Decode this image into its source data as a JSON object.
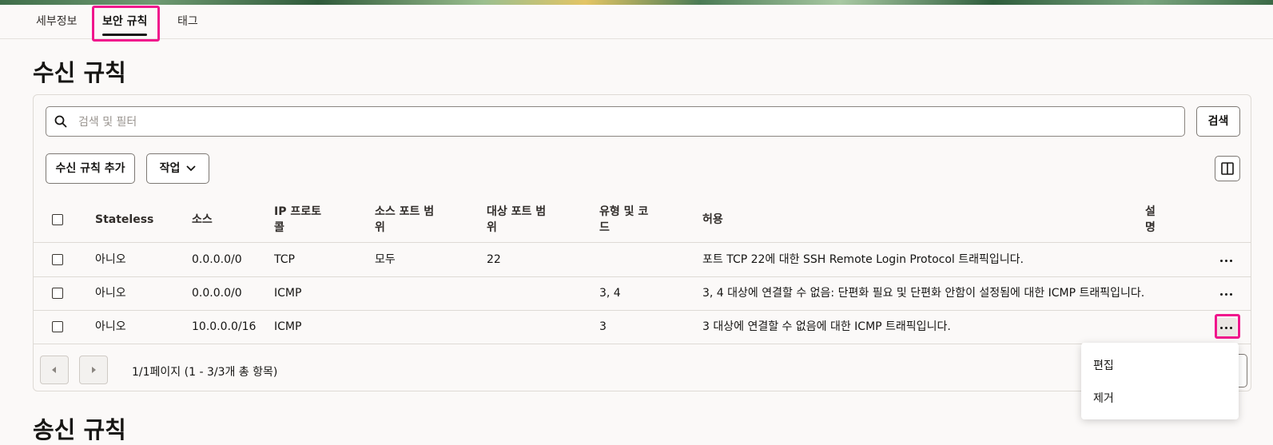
{
  "tabs": {
    "details": "세부정보",
    "security_rules": "보안 규칙",
    "tags": "태그"
  },
  "ingress": {
    "title": "수신 규칙",
    "search": {
      "placeholder": "검색 및 필터",
      "button": "검색"
    },
    "add_button": "수신 규칙 추가",
    "actions_button": "작업",
    "columns": {
      "stateless": "Stateless",
      "source": "소스",
      "protocol_l1": "IP 프로토",
      "protocol_l2": "콜",
      "src_port_l1": "소스 포트 범",
      "src_port_l2": "위",
      "dst_port_l1": "대상 포트 범",
      "dst_port_l2": "위",
      "type_l1": "유형 및 코",
      "type_l2": "드",
      "allows": "허용",
      "desc_l1": "설",
      "desc_l2": "명"
    },
    "rows": [
      {
        "stateless": "아니오",
        "source": "0.0.0.0/0",
        "protocol": "TCP",
        "src_port": "모두",
        "dst_port": "22",
        "type_code": "",
        "allows": "포트 TCP 22에 대한 SSH Remote Login Protocol 트래픽입니다."
      },
      {
        "stateless": "아니오",
        "source": "0.0.0.0/0",
        "protocol": "ICMP",
        "src_port": "",
        "dst_port": "",
        "type_code": "3, 4",
        "allows": "3, 4 대상에 연결할 수 없음: 단편화 필요 및 단편화 안함이 설정됨에 대한 ICMP 트래픽입니다."
      },
      {
        "stateless": "아니오",
        "source": "10.0.0.0/16",
        "protocol": "ICMP",
        "src_port": "",
        "dst_port": "",
        "type_code": "3",
        "allows": "3 대상에 연결할 수 없음에 대한 ICMP 트래픽입니다."
      }
    ],
    "pagination": "1/1페이지 (1 - 3/3개 총 항목)",
    "row_menu": {
      "edit": "편집",
      "remove": "제거"
    }
  },
  "egress": {
    "title": "송신 규칙"
  },
  "colors": {
    "highlight": "#f0168c",
    "text": "#161513",
    "background": "#fbf9f8"
  }
}
